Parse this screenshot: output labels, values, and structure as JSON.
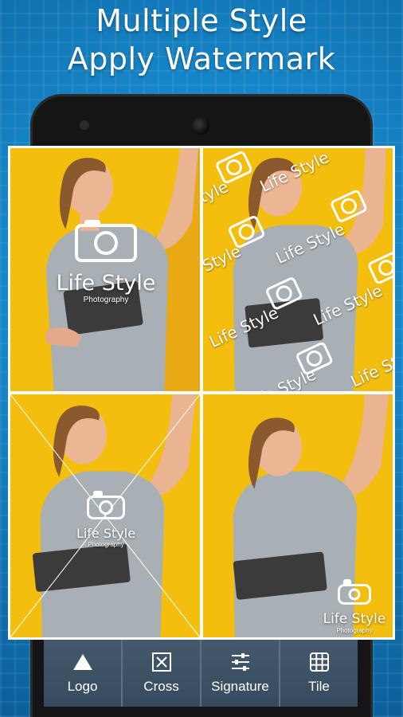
{
  "headline": {
    "line1": "Multiple Style",
    "line2": "Apply Watermark"
  },
  "watermark": {
    "brand": "Life Style",
    "sub": "Photography"
  },
  "toolbar": {
    "items": [
      {
        "label": "Logo",
        "icon": "triangle-icon"
      },
      {
        "label": "Cross",
        "icon": "cross-frame-icon"
      },
      {
        "label": "Signature",
        "icon": "sliders-icon"
      },
      {
        "label": "Tile",
        "icon": "grid-icon"
      }
    ]
  },
  "colors": {
    "background": "#1584c6",
    "photo_bg": "#f4be0e",
    "toolbar": "#3f5468",
    "watermark": "#ffffff"
  }
}
